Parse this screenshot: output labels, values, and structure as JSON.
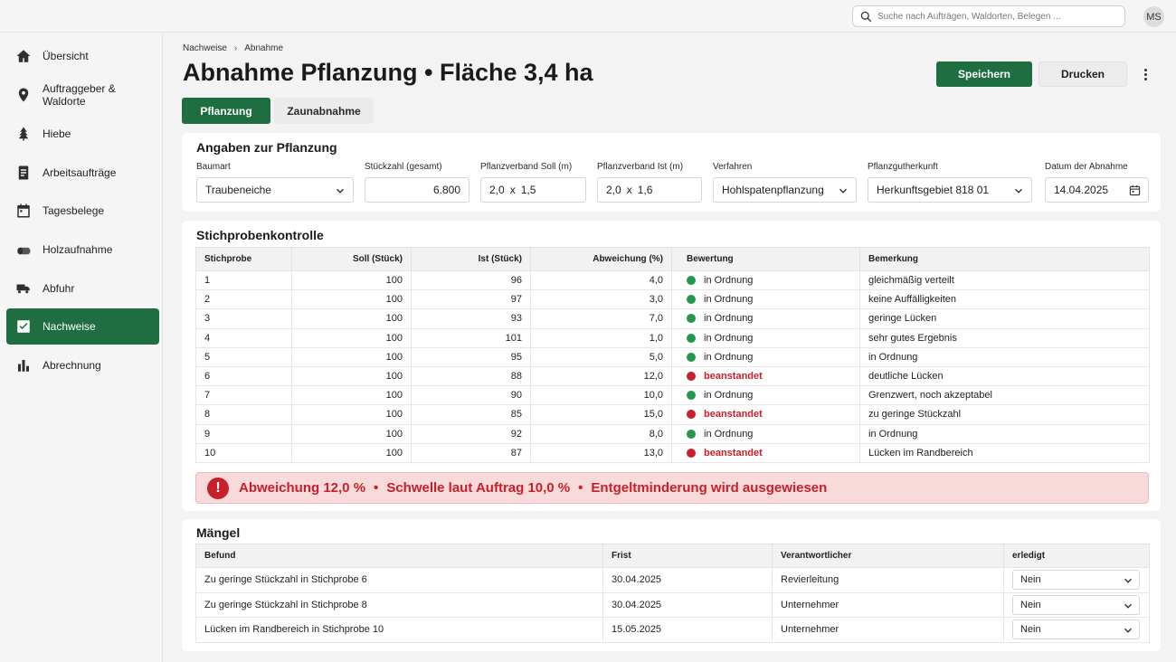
{
  "search": {
    "placeholder": "Suche nach Aufträgen, Waldorten, Belegen ..."
  },
  "user": {
    "initials": "MS"
  },
  "sidebar": {
    "items": [
      {
        "label": "Übersicht",
        "icon": "home-icon"
      },
      {
        "label": "Auftraggeber & Waldorte",
        "icon": "map-pin-icon"
      },
      {
        "label": "Hiebe",
        "icon": "tree-icon"
      },
      {
        "label": "Arbeitsaufträge",
        "icon": "document-icon"
      },
      {
        "label": "Tagesbelege",
        "icon": "calendar-icon"
      },
      {
        "label": "Holzaufnahme",
        "icon": "log-icon"
      },
      {
        "label": "Abfuhr",
        "icon": "truck-icon"
      },
      {
        "label": "Nachweise",
        "icon": "checkbox-icon",
        "active": true
      },
      {
        "label": "Abrechnung",
        "icon": "bar-chart-icon"
      }
    ]
  },
  "breadcrumb": {
    "parent": "Nachweise",
    "current": "Abnahme"
  },
  "header": {
    "title": "Abnahme Pflanzung • Fläche 3,4 ha",
    "save_label": "Speichern",
    "print_label": "Drucken"
  },
  "tabs": [
    {
      "label": "Pflanzung",
      "active": true
    },
    {
      "label": "Zaunabnahme",
      "active": false
    }
  ],
  "planting": {
    "title": "Angaben zur Pflanzung",
    "fields": {
      "baumart": {
        "label": "Baumart",
        "value": "Traubeneiche"
      },
      "stueckzahl": {
        "label": "Stückzahl (gesamt)",
        "value": "6.800"
      },
      "verband_soll": {
        "label": "Pflanzverband Soll (m)",
        "a": "2,0",
        "x": "x",
        "b": "1,5"
      },
      "verband_ist": {
        "label": "Pflanzverband Ist (m)",
        "a": "2,0",
        "x": "x",
        "b": "1,6"
      },
      "verfahren": {
        "label": "Verfahren",
        "value": "Hohlspatenpflanzung"
      },
      "herkunft": {
        "label": "Pflanzgutherkunft",
        "value": "Herkunftsgebiet 818 01"
      },
      "datum": {
        "label": "Datum der Abnahme",
        "value": "14.04.2025"
      }
    }
  },
  "sample": {
    "title": "Stichprobenkontrolle",
    "columns": [
      "Stichprobe",
      "Soll (Stück)",
      "Ist (Stück)",
      "Abweichung (%)",
      "Bewertung",
      "Bemerkung"
    ],
    "rows": [
      {
        "nr": "1",
        "soll": "100",
        "ist": "96",
        "abw": "4,0",
        "bewertung": "in Ordnung",
        "ok": true,
        "bemerkung": "gleichmäßig verteilt"
      },
      {
        "nr": "2",
        "soll": "100",
        "ist": "97",
        "abw": "3,0",
        "bewertung": "in Ordnung",
        "ok": true,
        "bemerkung": "keine Auffälligkeiten"
      },
      {
        "nr": "3",
        "soll": "100",
        "ist": "93",
        "abw": "7,0",
        "bewertung": "in Ordnung",
        "ok": true,
        "bemerkung": "geringe Lücken"
      },
      {
        "nr": "4",
        "soll": "100",
        "ist": "101",
        "abw": "1,0",
        "bewertung": "in Ordnung",
        "ok": true,
        "bemerkung": "sehr gutes Ergebnis"
      },
      {
        "nr": "5",
        "soll": "100",
        "ist": "95",
        "abw": "5,0",
        "bewertung": "in Ordnung",
        "ok": true,
        "bemerkung": "in Ordnung"
      },
      {
        "nr": "6",
        "soll": "100",
        "ist": "88",
        "abw": "12,0",
        "bewertung": "beanstandet",
        "ok": false,
        "bemerkung": "deutliche Lücken"
      },
      {
        "nr": "7",
        "soll": "100",
        "ist": "90",
        "abw": "10,0",
        "bewertung": "in Ordnung",
        "ok": true,
        "bemerkung": "Grenzwert, noch akzeptabel"
      },
      {
        "nr": "8",
        "soll": "100",
        "ist": "85",
        "abw": "15,0",
        "bewertung": "beanstandet",
        "ok": false,
        "bemerkung": "zu geringe Stückzahl"
      },
      {
        "nr": "9",
        "soll": "100",
        "ist": "92",
        "abw": "8,0",
        "bewertung": "in Ordnung",
        "ok": true,
        "bemerkung": "in Ordnung"
      },
      {
        "nr": "10",
        "soll": "100",
        "ist": "87",
        "abw": "13,0",
        "bewertung": "beanstandet",
        "ok": false,
        "bemerkung": "Lücken im Randbereich"
      }
    ]
  },
  "alert": {
    "icon": "!",
    "parts": [
      "Abweichung 12,0 %",
      "Schwelle laut Auftrag 10,0 %",
      "Entgeltminderung wird ausgewiesen"
    ],
    "bullet": "•"
  },
  "defects": {
    "title": "Mängel",
    "columns": [
      "Befund",
      "Frist",
      "Verantwortlicher",
      "erledigt"
    ],
    "rows": [
      {
        "befund": "Zu geringe Stückzahl in Stichprobe 6",
        "frist": "30.04.2025",
        "verantwortlich": "Revierleitung",
        "erledigt": "Nein"
      },
      {
        "befund": "Zu geringe Stückzahl in Stichprobe 8",
        "frist": "30.04.2025",
        "verantwortlich": "Unternehmer",
        "erledigt": "Nein"
      },
      {
        "befund": "Lücken im Randbereich in Stichprobe 10",
        "frist": "15.05.2025",
        "verantwortlich": "Unternehmer",
        "erledigt": "Nein"
      }
    ]
  },
  "colors": {
    "brand_green": "#1e6e41",
    "ok_green": "#1f9a4a",
    "alert_red": "#c8202a",
    "alert_bg": "#f9dada"
  }
}
